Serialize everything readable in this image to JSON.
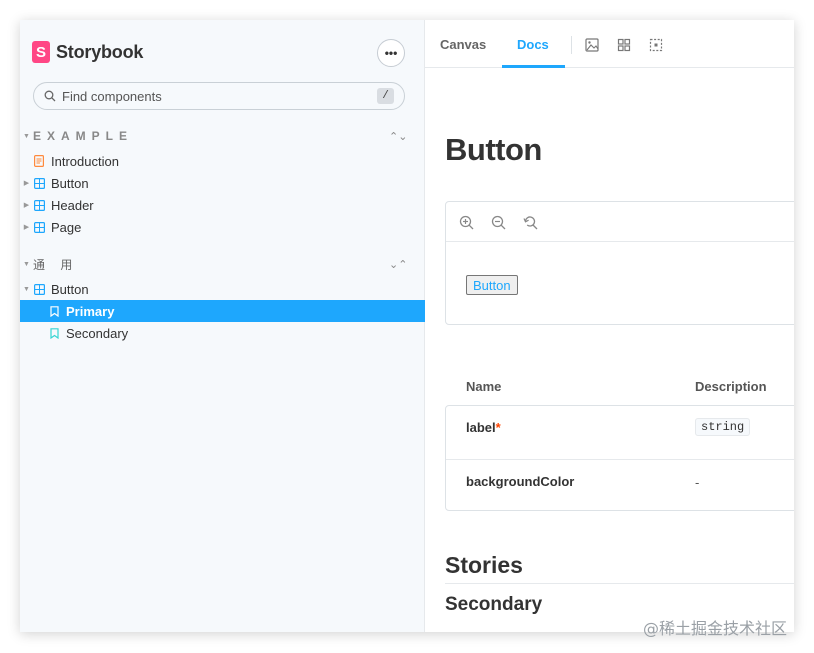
{
  "sidebar": {
    "brand": "Storybook",
    "brand_logo_letter": "S",
    "menu_label": "•••",
    "search": {
      "placeholder": "Find components",
      "shortcut": "/"
    },
    "groups": [
      {
        "title": "EXAMPLE",
        "toggle_icon": "expand-collapse-icon",
        "items": [
          {
            "label": "Introduction",
            "icon": "document-icon",
            "color": "#ff8a3d"
          },
          {
            "label": "Button",
            "icon": "component-icon",
            "color": "#1ea7fd"
          },
          {
            "label": "Header",
            "icon": "component-icon",
            "color": "#1ea7fd"
          },
          {
            "label": "Page",
            "icon": "component-icon",
            "color": "#1ea7fd"
          }
        ]
      },
      {
        "title": "通 用",
        "toggle_icon": "collapse-icon",
        "items": [
          {
            "label": "Button",
            "icon": "component-icon",
            "color": "#1ea7fd"
          },
          {
            "label": "Primary",
            "icon": "story-bookmark-icon",
            "selected": true
          },
          {
            "label": "Secondary",
            "icon": "story-bookmark-icon",
            "color": "#37d5d3"
          }
        ]
      }
    ]
  },
  "toolbar": {
    "tabs": [
      "Canvas",
      "Docs"
    ],
    "active_tab": "Docs",
    "icons": [
      "image-icon",
      "grid-icon",
      "outline-icon"
    ]
  },
  "docs": {
    "title": "Button",
    "preview": {
      "tools": [
        "zoom-in-icon",
        "zoom-out-icon",
        "reset-zoom-icon"
      ],
      "button_label": "Button"
    },
    "props_table": {
      "headers": [
        "Name",
        "Description"
      ],
      "rows": [
        {
          "name": "label",
          "required_mark": "*",
          "description": "string",
          "is_code": true
        },
        {
          "name": "backgroundColor",
          "required_mark": "",
          "description": "-",
          "is_code": false
        }
      ]
    },
    "stories_heading": "Stories",
    "story_heading": "Secondary"
  },
  "watermark": "@稀土掘金技术社区",
  "colors": {
    "accent": "#1ea7fd",
    "brand": "#ff4785",
    "required": "#ff4400"
  }
}
